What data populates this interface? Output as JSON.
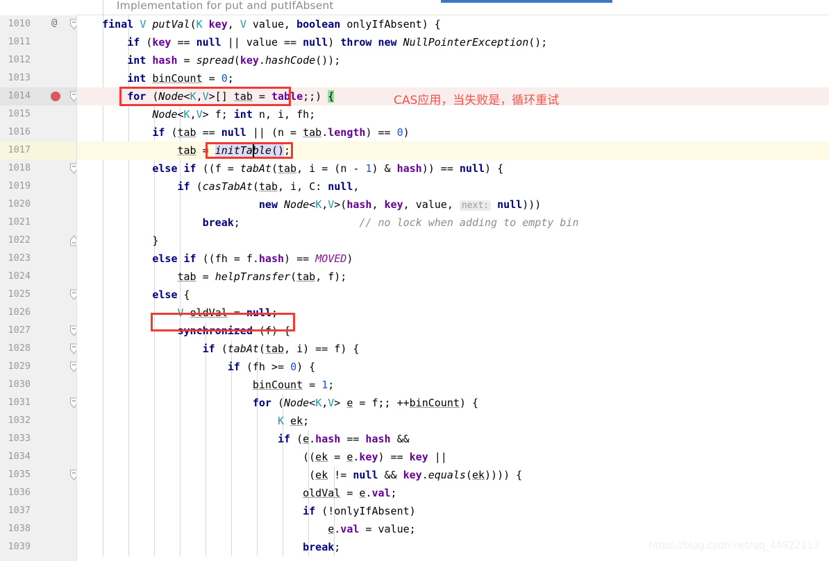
{
  "editor": {
    "sticky_header_label": "Implementation for put and putIfAbsent",
    "first_line_number": 1010,
    "line_height": 26,
    "watermark": "https://blog.csdn.net/qq_44922113"
  },
  "colors": {
    "keyword": "#000080",
    "type_param": "#20999d",
    "field": "#660099",
    "static_field": "#871094",
    "number": "#1750eb",
    "comment": "#8c8c8c",
    "annotation_red": "#ef3b36",
    "note_text": "#f4544b",
    "breakpoint": "#db5860",
    "caret_line": "#fffae3",
    "breakpoint_line": "#faeded",
    "selection": "#dcdcf7",
    "brace_match": "#93e293",
    "gutter_bg": "#f0f0f0",
    "tab_indicator": "#3b79c4"
  },
  "gutter": {
    "lines": [
      {
        "n": "1010",
        "marker": "override-marker",
        "fold": "fold-start"
      },
      {
        "n": "1011",
        "marker": "",
        "fold": ""
      },
      {
        "n": "1012",
        "marker": "",
        "fold": ""
      },
      {
        "n": "1013",
        "marker": "",
        "fold": ""
      },
      {
        "n": "1014",
        "marker": "breakpoint",
        "fold": "fold-start"
      },
      {
        "n": "1015",
        "marker": "",
        "fold": ""
      },
      {
        "n": "1016",
        "marker": "",
        "fold": ""
      },
      {
        "n": "1017",
        "marker": "",
        "fold": ""
      },
      {
        "n": "1018",
        "marker": "",
        "fold": "fold-start"
      },
      {
        "n": "1019",
        "marker": "",
        "fold": ""
      },
      {
        "n": "1020",
        "marker": "",
        "fold": ""
      },
      {
        "n": "1021",
        "marker": "",
        "fold": ""
      },
      {
        "n": "1022",
        "marker": "",
        "fold": "fold-end"
      },
      {
        "n": "1023",
        "marker": "",
        "fold": ""
      },
      {
        "n": "1024",
        "marker": "",
        "fold": ""
      },
      {
        "n": "1025",
        "marker": "",
        "fold": "fold-start"
      },
      {
        "n": "1026",
        "marker": "",
        "fold": ""
      },
      {
        "n": "1027",
        "marker": "",
        "fold": "fold-start"
      },
      {
        "n": "1028",
        "marker": "",
        "fold": "fold-start"
      },
      {
        "n": "1029",
        "marker": "",
        "fold": "fold-start"
      },
      {
        "n": "1030",
        "marker": "",
        "fold": ""
      },
      {
        "n": "1031",
        "marker": "",
        "fold": "fold-start"
      },
      {
        "n": "1032",
        "marker": "",
        "fold": ""
      },
      {
        "n": "1033",
        "marker": "",
        "fold": ""
      },
      {
        "n": "1034",
        "marker": "",
        "fold": ""
      },
      {
        "n": "1035",
        "marker": "",
        "fold": "fold-start"
      },
      {
        "n": "1036",
        "marker": "",
        "fold": ""
      },
      {
        "n": "1037",
        "marker": "",
        "fold": ""
      },
      {
        "n": "1038",
        "marker": "",
        "fold": ""
      },
      {
        "n": "1039",
        "marker": "",
        "fold": ""
      }
    ]
  },
  "code_lines": [
    {
      "n": "1010",
      "text": "    final V putVal(K key, V value, boolean onlyIfAbsent) {"
    },
    {
      "n": "1011",
      "text": "        if (key == null || value == null) throw new NullPointerException();"
    },
    {
      "n": "1012",
      "text": "        int hash = spread(key.hashCode());"
    },
    {
      "n": "1013",
      "text": "        int binCount = 0;"
    },
    {
      "n": "1014",
      "text": "        for (Node<K,V>[] tab = table;;) {"
    },
    {
      "n": "1015",
      "text": "            Node<K,V> f; int n, i, fh;"
    },
    {
      "n": "1016",
      "text": "            if (tab == null || (n = tab.length) == 0)"
    },
    {
      "n": "1017",
      "text": "                tab = initTable();"
    },
    {
      "n": "1018",
      "text": "            else if ((f = tabAt(tab, i = (n - 1) & hash)) == null) {"
    },
    {
      "n": "1019",
      "text": "                if (casTabAt(tab, i, C: null,"
    },
    {
      "n": "1020",
      "text": "                             new Node<K,V>(hash, key, value, next: null)))"
    },
    {
      "n": "1021",
      "text": "                    break;                   // no lock when adding to empty bin"
    },
    {
      "n": "1022",
      "text": "            }"
    },
    {
      "n": "1023",
      "text": "            else if ((fh = f.hash) == MOVED)"
    },
    {
      "n": "1024",
      "text": "                tab = helpTransfer(tab, f);"
    },
    {
      "n": "1025",
      "text": "            else {"
    },
    {
      "n": "1026",
      "text": "                V oldVal = null;"
    },
    {
      "n": "1027",
      "text": "                synchronized (f) {"
    },
    {
      "n": "1028",
      "text": "                    if (tabAt(tab, i) == f) {"
    },
    {
      "n": "1029",
      "text": "                        if (fh >= 0) {"
    },
    {
      "n": "1030",
      "text": "                            binCount = 1;"
    },
    {
      "n": "1031",
      "text": "                            for (Node<K,V> e = f;; ++binCount) {"
    },
    {
      "n": "1032",
      "text": "                                K ek;"
    },
    {
      "n": "1033",
      "text": "                                if (e.hash == hash &&"
    },
    {
      "n": "1034",
      "text": "                                    ((ek = e.key) == key ||"
    },
    {
      "n": "1035",
      "text": "                                     (ek != null && key.equals(ek)))) {"
    },
    {
      "n": "1036",
      "text": "                                    oldVal = e.val;"
    },
    {
      "n": "1037",
      "text": "                                    if (!onlyIfAbsent)"
    },
    {
      "n": "1038",
      "text": "                                        e.val = value;"
    },
    {
      "n": "1039",
      "text": "                                    break;"
    }
  ],
  "annotations": {
    "note_cas": "CAS应用，当失败是，循环重试",
    "boxes": [
      {
        "name": "for-loop-box",
        "line": "1014"
      },
      {
        "name": "init-table-box",
        "line": "1017"
      },
      {
        "name": "synchronized-box",
        "line": "1027"
      }
    ]
  },
  "inlay_hints": [
    {
      "line": "1019",
      "label": "C:"
    },
    {
      "line": "1020",
      "label": "next:"
    }
  ]
}
